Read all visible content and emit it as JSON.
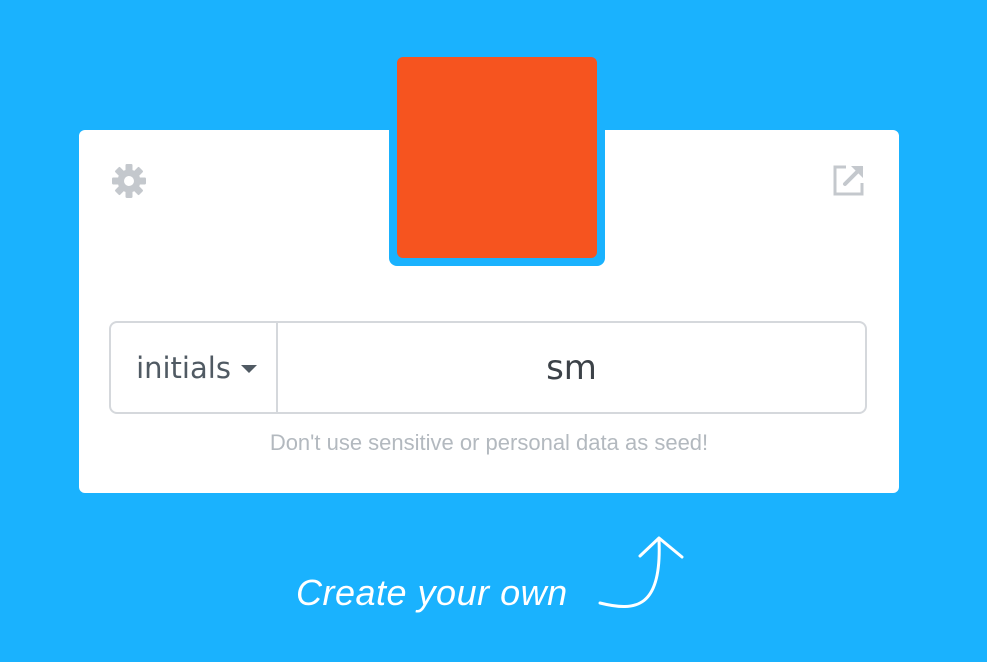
{
  "avatar": {
    "color": "#f6541f",
    "frame_color": "#1ab2fe"
  },
  "toolbar": {
    "settings_icon": "gear-icon",
    "open_icon": "external-link-icon"
  },
  "seed_form": {
    "style_value": "initials",
    "seed_value": "sm",
    "warning": "Don't use sensitive or personal data as seed!"
  },
  "footer": {
    "cta_label": "Create your own",
    "arrow_icon": "curved-arrow-up-icon"
  },
  "colors": {
    "background": "#1ab2fe",
    "card": "#ffffff",
    "icon_gray": "#c4c8cd"
  }
}
